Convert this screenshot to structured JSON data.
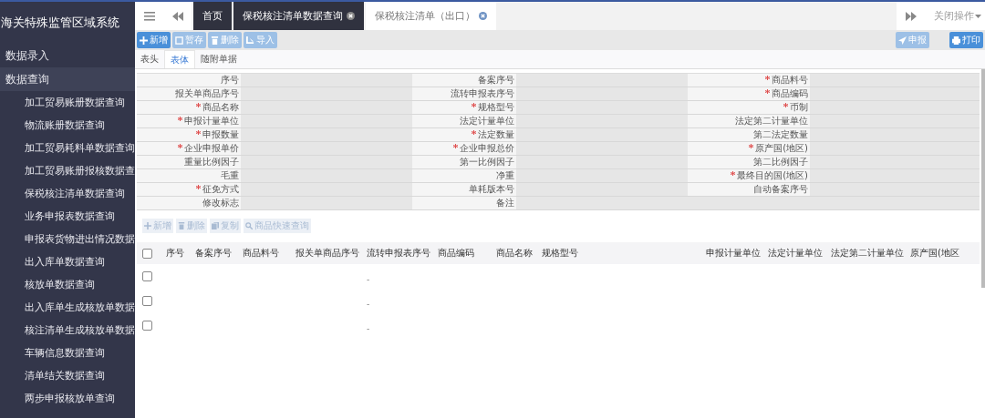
{
  "sidebar": {
    "title": "海关特殊监管区域系统",
    "items": [
      {
        "label": "数据录入",
        "expanded": false
      },
      {
        "label": "数据查询",
        "expanded": true,
        "children": [
          {
            "label": "加工贸易账册数据查询"
          },
          {
            "label": "物流账册数据查询"
          },
          {
            "label": "加工贸易耗料单数据查询"
          },
          {
            "label": "加工贸易账册报核数据查"
          },
          {
            "label": "保税核注清单数据查询"
          },
          {
            "label": "业务申报表数据查询"
          },
          {
            "label": "申报表货物进出情况数据"
          },
          {
            "label": "出入库单数据查询"
          },
          {
            "label": "核放单数据查询"
          },
          {
            "label": "出入库单生成核放单数据"
          },
          {
            "label": "核注清单生成核放单数据"
          },
          {
            "label": "车辆信息数据查询"
          },
          {
            "label": "清单结关数据查询"
          },
          {
            "label": "两步申报核放单查询"
          }
        ]
      }
    ]
  },
  "tabs": [
    {
      "label": "首页",
      "selected": false,
      "closable": false
    },
    {
      "label": "保税核注清单数据查询",
      "selected": false,
      "closable": true
    },
    {
      "label": "保税核注清单（出口）",
      "selected": true,
      "closable": true
    }
  ],
  "tab_menu": "关闭操作",
  "toolbar": {
    "left": [
      {
        "label": "新增",
        "kind": "plus",
        "disabled": false
      },
      {
        "label": "暂存",
        "kind": "save",
        "disabled": true
      },
      {
        "label": "删除",
        "kind": "trash",
        "disabled": true
      },
      {
        "label": "导入",
        "kind": "import",
        "disabled": true
      }
    ],
    "right": [
      {
        "label": "申报",
        "kind": "send",
        "disabled": true
      },
      {
        "label": "打印",
        "kind": "print",
        "disabled": false
      }
    ]
  },
  "subtabs": [
    {
      "label": "表头",
      "selected": false
    },
    {
      "label": "表体",
      "selected": true
    },
    {
      "label": "随附单据",
      "selected": false
    }
  ],
  "form_rows": [
    [
      {
        "label": "序号",
        "required": false
      },
      {
        "label": "备案序号",
        "required": false
      },
      {
        "label": "商品料号",
        "required": true
      }
    ],
    [
      {
        "label": "报关单商品序号",
        "required": false
      },
      {
        "label": "流转申报表序号",
        "required": false
      },
      {
        "label": "商品编码",
        "required": true
      }
    ],
    [
      {
        "label": "商品名称",
        "required": true
      },
      {
        "label": "规格型号",
        "required": true
      },
      {
        "label": "币制",
        "required": true
      }
    ],
    [
      {
        "label": "申报计量单位",
        "required": true
      },
      {
        "label": "法定计量单位",
        "required": false
      },
      {
        "label": "法定第二计量单位",
        "required": false
      }
    ],
    [
      {
        "label": "申报数量",
        "required": true
      },
      {
        "label": "法定数量",
        "required": true
      },
      {
        "label": "第二法定数量",
        "required": false
      }
    ],
    [
      {
        "label": "企业申报单价",
        "required": true
      },
      {
        "label": "企业申报总价",
        "required": true
      },
      {
        "label": "原产国(地区)",
        "required": true
      }
    ],
    [
      {
        "label": "重量比例因子",
        "required": false
      },
      {
        "label": "第一比例因子",
        "required": false
      },
      {
        "label": "第二比例因子",
        "required": false
      }
    ],
    [
      {
        "label": "毛重",
        "required": false
      },
      {
        "label": "净重",
        "required": false
      },
      {
        "label": "最终目的国(地区)",
        "required": true
      }
    ],
    [
      {
        "label": "征免方式",
        "required": true
      },
      {
        "label": "单耗版本号",
        "required": false
      },
      {
        "label": "自动备案序号",
        "required": false
      }
    ],
    [
      {
        "label": "修改标志",
        "required": false
      },
      {
        "label": "备注",
        "required": false
      }
    ]
  ],
  "grid_toolbar": [
    {
      "label": "新增",
      "kind": "plus",
      "disabled": true
    },
    {
      "label": "删除",
      "kind": "trash",
      "disabled": true
    },
    {
      "label": "复制",
      "kind": "copy",
      "disabled": true
    },
    {
      "label": "商品快速查询",
      "kind": "search",
      "disabled": true
    }
  ],
  "grid": {
    "all_checked": false,
    "columns": [
      "序号",
      "备案序号",
      "商品料号",
      "报关单商品序号",
      "流转申报表序号",
      "商品编码",
      "商品名称",
      "规格型号",
      "申报计量单位",
      "法定计量单位",
      "法定第二计量单位",
      "原产国(地区"
    ],
    "rows": [
      {
        "checked": false,
        "transfer_no": "-"
      },
      {
        "checked": false,
        "transfer_no": "-"
      },
      {
        "checked": false,
        "transfer_no": "-"
      }
    ]
  }
}
